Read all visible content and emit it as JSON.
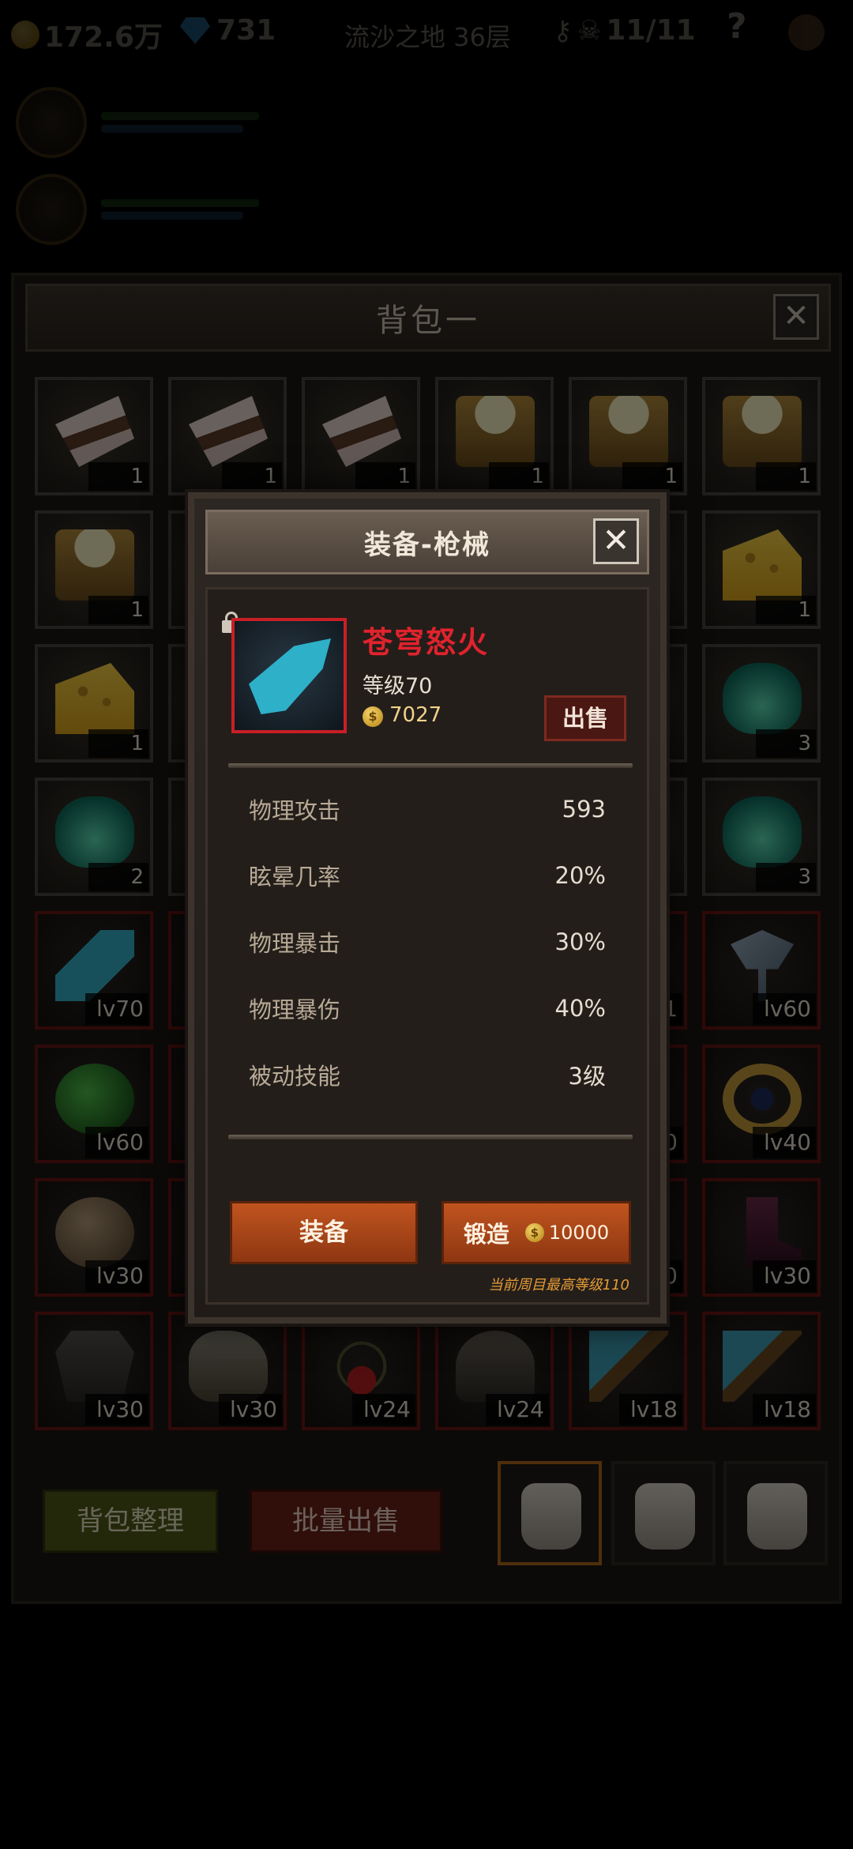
{
  "hud": {
    "gold": "172.6万",
    "gems": "731",
    "location": "流沙之地 36层",
    "skulls": "11/11",
    "help": "?"
  },
  "inventory": {
    "title": "背包一",
    "close": "✕",
    "slots": [
      {
        "icon": "cake-icon",
        "qty": "1"
      },
      {
        "icon": "cake-icon",
        "qty": "1"
      },
      {
        "icon": "cake-icon",
        "qty": "1"
      },
      {
        "icon": "beer-icon",
        "qty": "1"
      },
      {
        "icon": "beer-icon",
        "qty": "1"
      },
      {
        "icon": "beer-icon",
        "qty": "1"
      },
      {
        "icon": "beer-icon",
        "qty": "1"
      },
      {
        "icon": "hidden",
        "qty": ""
      },
      {
        "icon": "hidden",
        "qty": ""
      },
      {
        "icon": "hidden",
        "qty": ""
      },
      {
        "icon": "hidden",
        "qty": ""
      },
      {
        "icon": "cheese-icon",
        "qty": "1"
      },
      {
        "icon": "cheese-icon",
        "qty": "1"
      },
      {
        "icon": "hidden",
        "qty": ""
      },
      {
        "icon": "hidden",
        "qty": ""
      },
      {
        "icon": "hidden",
        "qty": ""
      },
      {
        "icon": "hidden",
        "qty": ""
      },
      {
        "icon": "potion-icon",
        "qty": "3"
      },
      {
        "icon": "potion-icon",
        "qty": "2"
      },
      {
        "icon": "hidden",
        "qty": ""
      },
      {
        "icon": "hidden",
        "qty": ""
      },
      {
        "icon": "hidden",
        "qty": ""
      },
      {
        "icon": "hidden",
        "qty": ""
      },
      {
        "icon": "potion-icon",
        "qty": "3"
      },
      {
        "icon": "gun-icon",
        "lv": "lv70"
      },
      {
        "icon": "hidden",
        "lv": ""
      },
      {
        "icon": "hidden",
        "lv": ""
      },
      {
        "icon": "hidden",
        "lv": ""
      },
      {
        "icon": "hidden",
        "lv": "1"
      },
      {
        "icon": "axe-icon",
        "lv": "lv60"
      },
      {
        "icon": "orb-icon",
        "lv": "lv60"
      },
      {
        "icon": "hidden",
        "lv": ""
      },
      {
        "icon": "hidden",
        "lv": ""
      },
      {
        "icon": "hidden",
        "lv": ""
      },
      {
        "icon": "hidden",
        "lv": "0"
      },
      {
        "icon": "ring-icon",
        "lv": "lv40"
      },
      {
        "icon": "ball-icon",
        "lv": "lv30"
      },
      {
        "icon": "hidden",
        "lv": ""
      },
      {
        "icon": "hidden",
        "lv": ""
      },
      {
        "icon": "hidden",
        "lv": ""
      },
      {
        "icon": "hidden",
        "lv": "0"
      },
      {
        "icon": "boot-icon",
        "lv": "lv30"
      },
      {
        "icon": "armor-icon",
        "lv": "lv30"
      },
      {
        "icon": "glove-icon",
        "lv": "lv30"
      },
      {
        "icon": "necklace-icon",
        "lv": "lv24"
      },
      {
        "icon": "helm-icon",
        "lv": "lv24"
      },
      {
        "icon": "polearm-icon",
        "lv": "lv18"
      },
      {
        "icon": "polearm-icon",
        "lv": "lv18"
      }
    ],
    "sort_label": "背包整理",
    "batch_sell_label": "批量出售"
  },
  "modal": {
    "title": "装备-枪械",
    "close": "✕",
    "item_name": "苍穹怒火",
    "item_level": "等级70",
    "coin_symbol": "$",
    "item_price": "7027",
    "sell_label": "出售",
    "stats": [
      {
        "name": "物理攻击",
        "value": "593"
      },
      {
        "name": "眩晕几率",
        "value": "20%"
      },
      {
        "name": "物理暴击",
        "value": "30%"
      },
      {
        "name": "物理暴伤",
        "value": "40%"
      },
      {
        "name": "被动技能",
        "value": "3级"
      }
    ],
    "equip_label": "装备",
    "forge_label": "锻造",
    "forge_cost": "10000",
    "max_level_note": "当前周目最高等级110",
    "colors": {
      "item_name": "#e0232d",
      "frame": "#c81f26",
      "button": "#c0541f"
    }
  }
}
